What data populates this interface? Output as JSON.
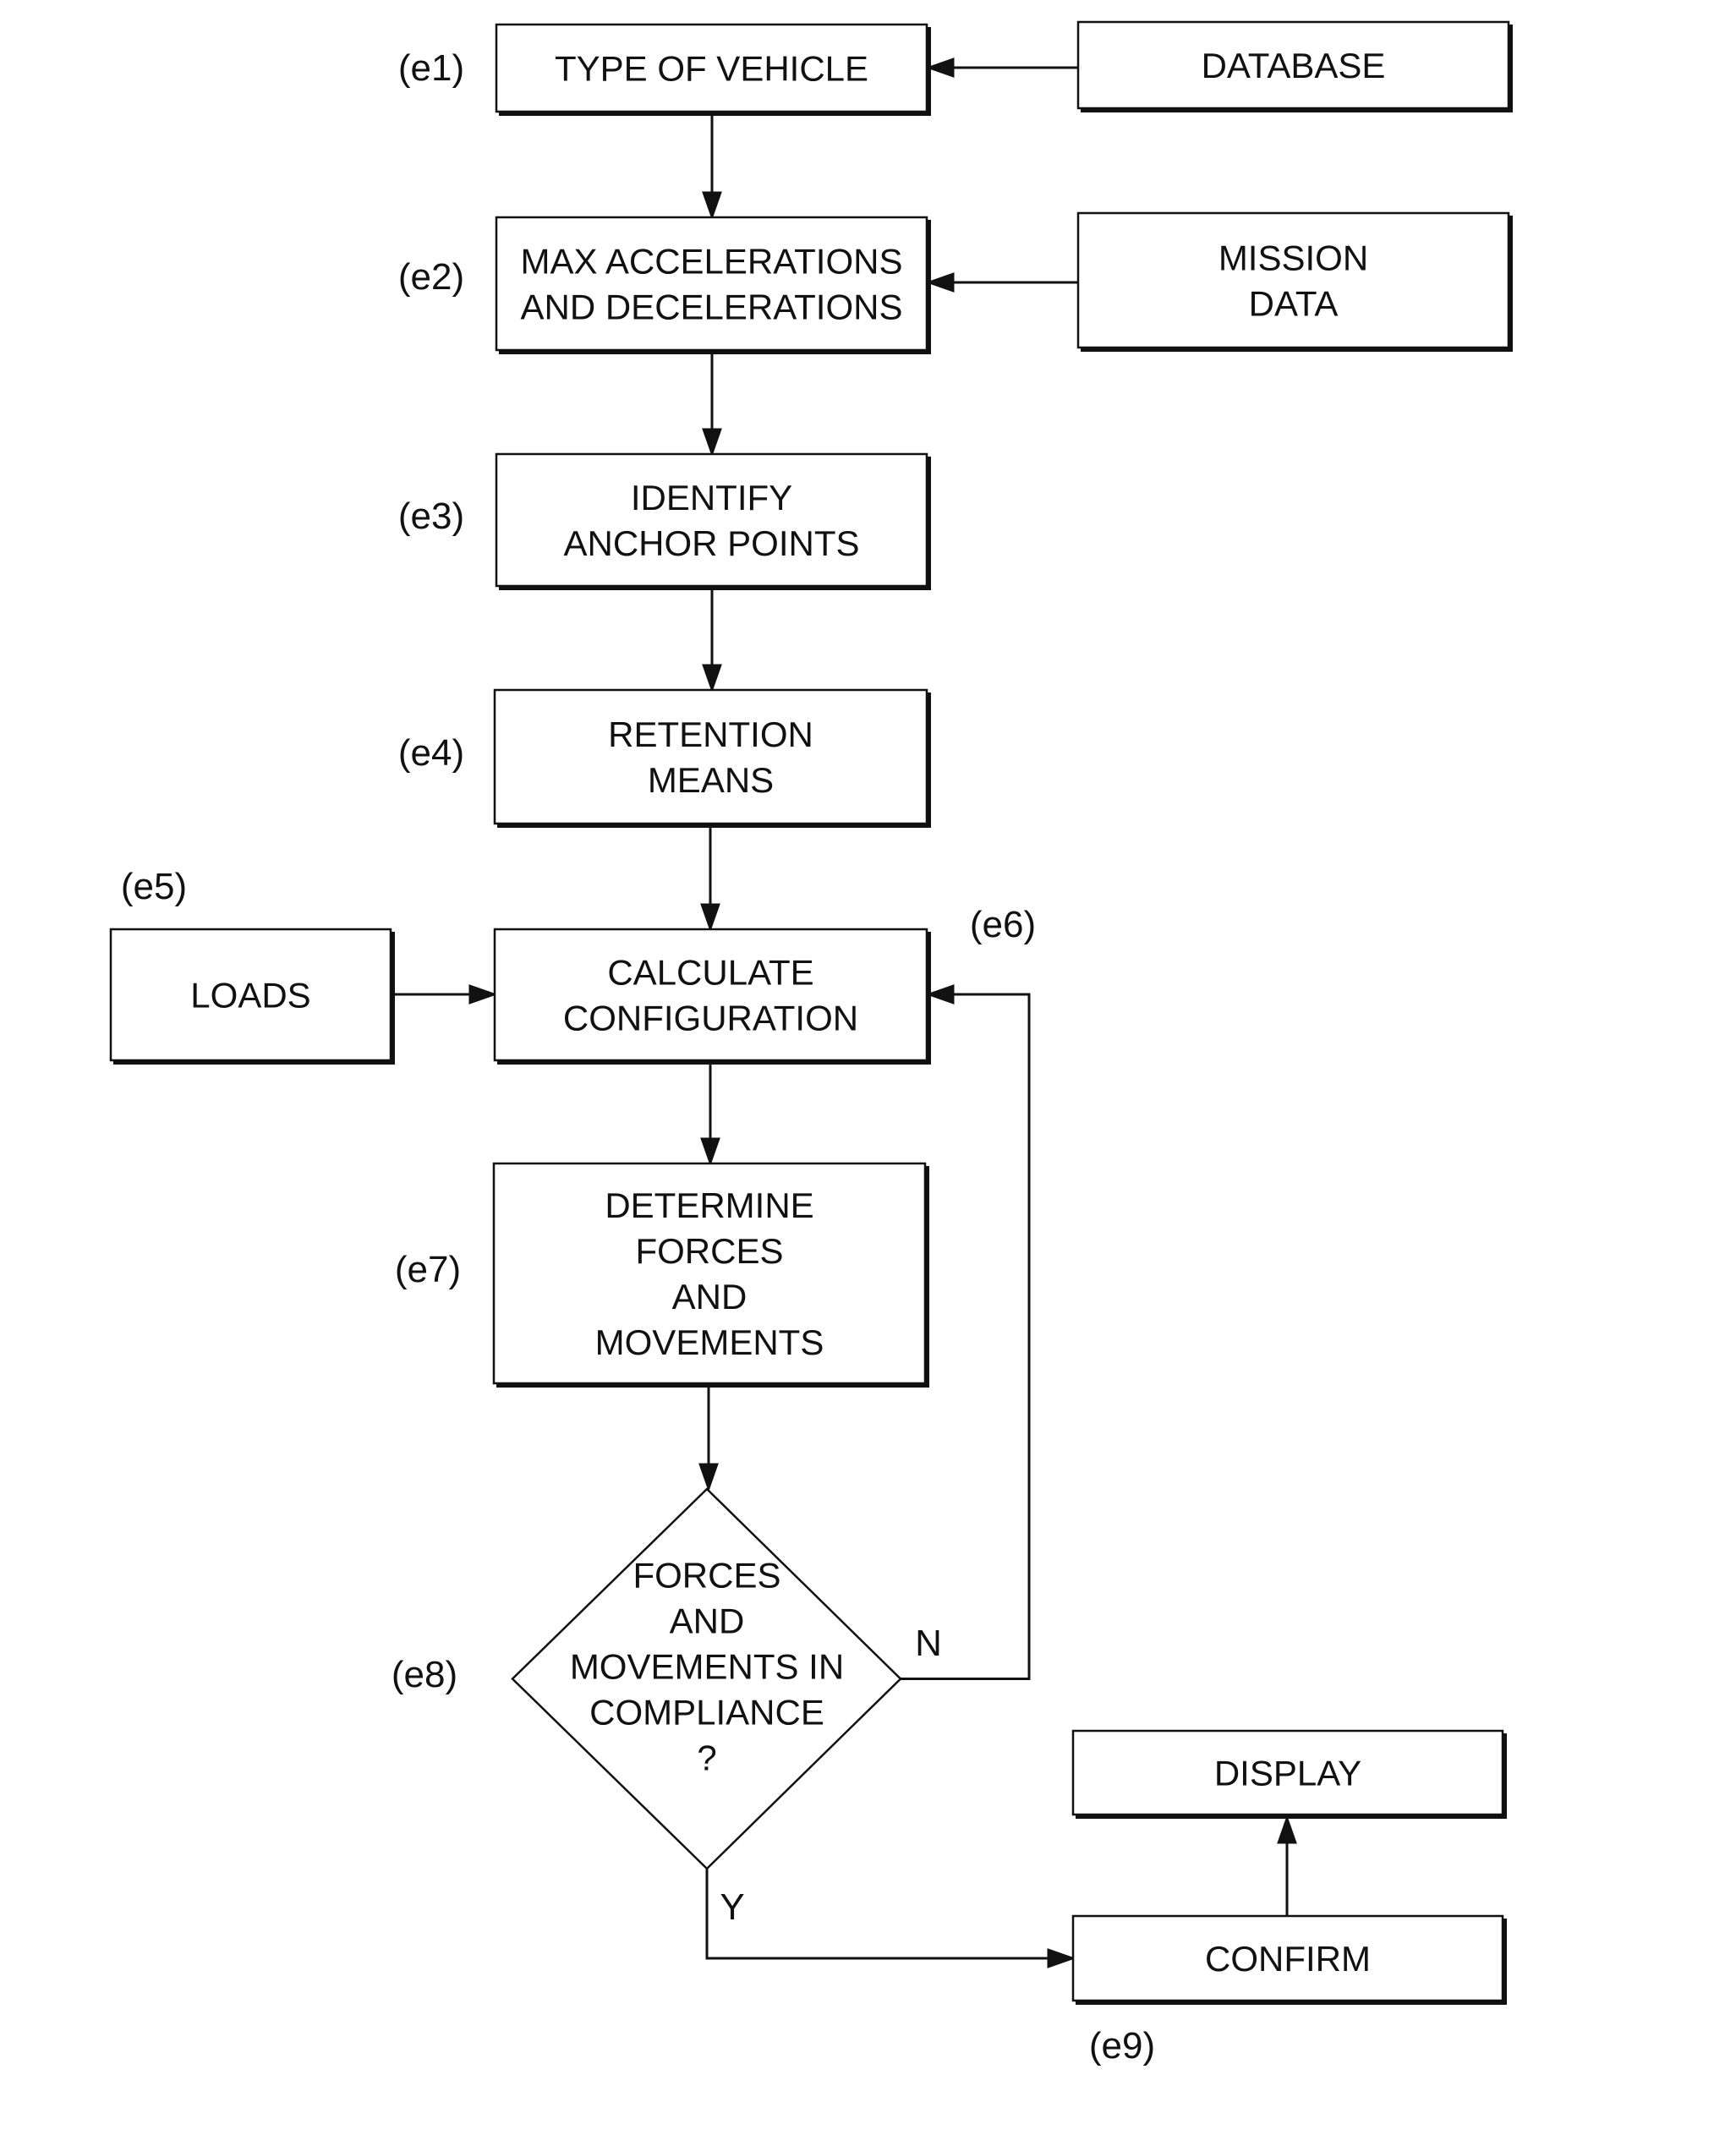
{
  "diagram": {
    "type": "flowchart",
    "nodes": [
      {
        "id": "e1",
        "label": "(e1)",
        "lines": [
          "TYPE OF VEHICLE"
        ]
      },
      {
        "id": "database",
        "lines": [
          "DATABASE"
        ]
      },
      {
        "id": "e2",
        "label": "(e2)",
        "lines": [
          "MAX ACCELERATIONS",
          "AND DECELERATIONS"
        ]
      },
      {
        "id": "mission",
        "lines": [
          "MISSION",
          "DATA"
        ]
      },
      {
        "id": "e3",
        "label": "(e3)",
        "lines": [
          "IDENTIFY",
          "ANCHOR POINTS"
        ]
      },
      {
        "id": "e4",
        "label": "(e4)",
        "lines": [
          "RETENTION",
          "MEANS"
        ]
      },
      {
        "id": "e5",
        "label": "(e5)",
        "lines": [
          "LOADS"
        ]
      },
      {
        "id": "e6",
        "label": "(e6)",
        "lines": [
          "CALCULATE",
          "CONFIGURATION"
        ]
      },
      {
        "id": "e7",
        "label": "(e7)",
        "lines": [
          "DETERMINE",
          "FORCES",
          "AND",
          "MOVEMENTS"
        ]
      },
      {
        "id": "e8",
        "label": "(e8)",
        "shape": "diamond",
        "lines": [
          "FORCES",
          "AND",
          "MOVEMENTS IN",
          "COMPLIANCE",
          "?"
        ]
      },
      {
        "id": "display",
        "lines": [
          "DISPLAY"
        ]
      },
      {
        "id": "e9",
        "label": "(e9)",
        "lines": [
          "CONFIRM"
        ]
      }
    ],
    "edges": [
      {
        "from": "database",
        "to": "e1"
      },
      {
        "from": "e1",
        "to": "e2"
      },
      {
        "from": "mission",
        "to": "e2"
      },
      {
        "from": "e2",
        "to": "e3"
      },
      {
        "from": "e3",
        "to": "e4"
      },
      {
        "from": "e4",
        "to": "e6"
      },
      {
        "from": "e5",
        "to": "e6"
      },
      {
        "from": "e6",
        "to": "e7"
      },
      {
        "from": "e7",
        "to": "e8"
      },
      {
        "from": "e8",
        "to": "e6",
        "label": "N"
      },
      {
        "from": "e8",
        "to": "e9",
        "label": "Y"
      },
      {
        "from": "e9",
        "to": "display"
      }
    ],
    "edge_labels": {
      "no": "N",
      "yes": "Y"
    }
  }
}
